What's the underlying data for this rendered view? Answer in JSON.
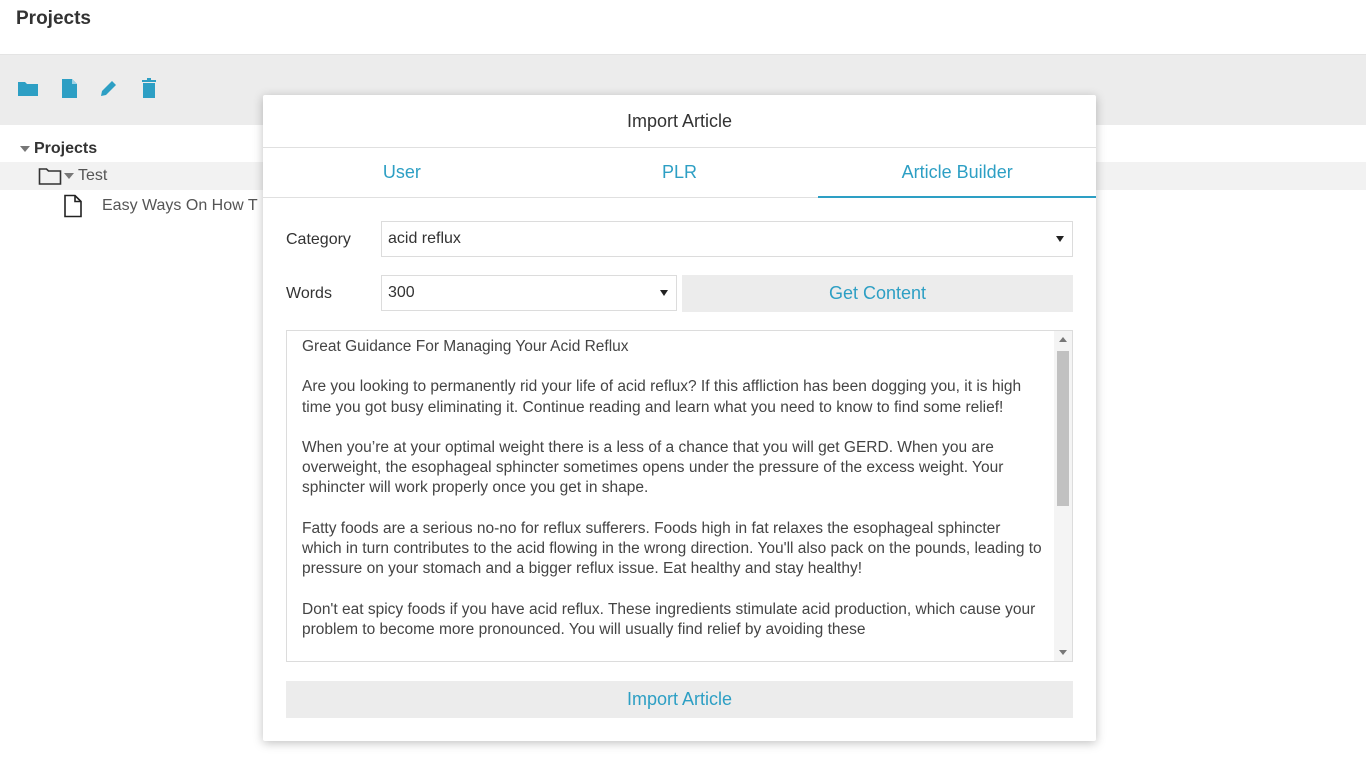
{
  "app": {
    "title": "Projects"
  },
  "toolbar": {
    "icons": [
      "folder-icon",
      "file-icon",
      "pencil-icon",
      "trash-icon"
    ],
    "accent": "#2d9fc4"
  },
  "tree": {
    "root": "Projects",
    "folder": "Test",
    "file": "Easy Ways On How T"
  },
  "modal": {
    "title": "Import Article",
    "tabs": [
      "User",
      "PLR",
      "Article Builder"
    ],
    "active_tab": "Article Builder",
    "category_label": "Category",
    "category_value": "acid reflux",
    "words_label": "Words",
    "words_value": "300",
    "get_content_label": "Get Content",
    "import_label": "Import Article",
    "article": [
      "Great Guidance For Managing Your Acid Reflux",
      "Are you looking to permanently rid your life of acid reflux? If this affliction has been dogging you, it is high time you got busy eliminating it. Continue reading and learn what you need to know to find some relief!",
      "When you’re at your optimal weight there is a less of a chance that you will get GERD. When you are overweight, the esophageal sphincter sometimes opens under the pressure of the excess weight. Your sphincter will work properly once you get in shape.",
      "Fatty foods are a serious no-no for reflux sufferers. Foods high in fat relaxes the esophageal sphincter which in turn contributes to the acid flowing in the wrong direction. You'll also pack on the pounds, leading to pressure on your stomach and a bigger reflux issue. Eat healthy and stay healthy!",
      "Don't eat spicy foods if you have acid reflux. These ingredients stimulate acid production, which cause your problem to become more pronounced. You will usually find relief by avoiding these"
    ]
  }
}
